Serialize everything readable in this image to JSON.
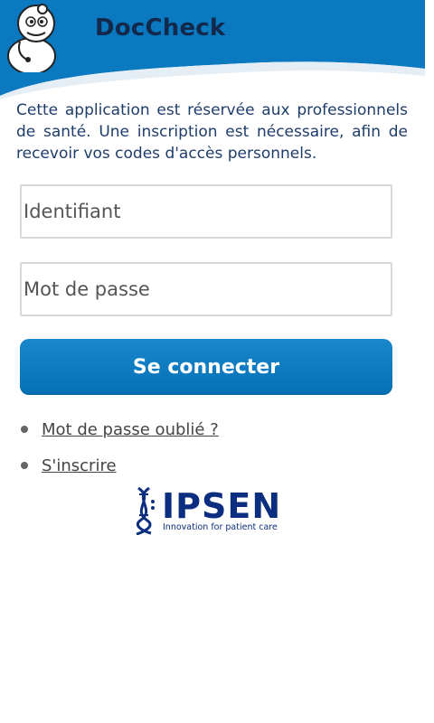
{
  "header": {
    "brand": "DocCheck"
  },
  "intro_text": "Cette application est réservée aux professionnels de santé. Une inscription est nécessaire, afin de recevoir vos codes d'accès personnels.",
  "form": {
    "username_placeholder": "Identifiant",
    "password_placeholder": "Mot de passe",
    "submit_label": "Se connecter"
  },
  "links": [
    {
      "label": "Mot de passe oublié ?"
    },
    {
      "label": "S'inscrire"
    }
  ],
  "sponsor": {
    "name": "IPSEN",
    "tagline": "Innovation for patient care"
  },
  "colors": {
    "header_blue": "#0a79c0",
    "button_blue": "#0c7bc1",
    "text_navy": "#1e3d6b"
  }
}
